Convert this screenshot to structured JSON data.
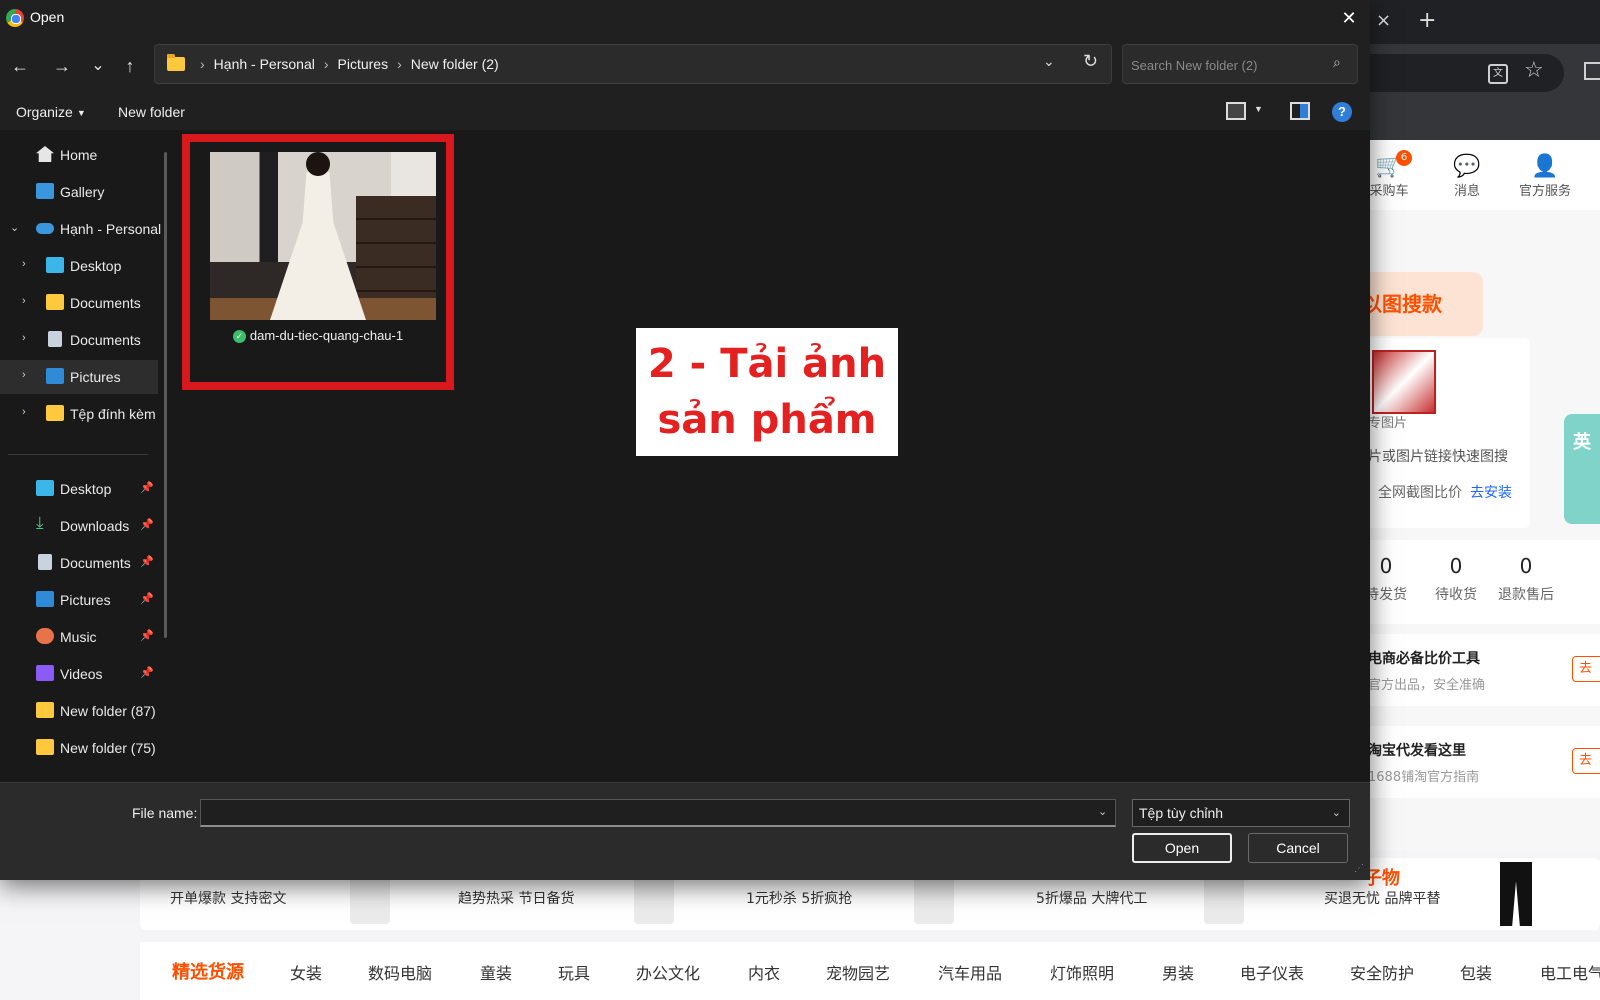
{
  "dialog": {
    "title": "Open",
    "icons": {
      "app": "chrome-logo-icon",
      "close": "close-icon"
    },
    "nav": {
      "back": "←",
      "forward": "→",
      "recent": "⌄",
      "up": "↑",
      "breadcrumbs": [
        "Hạnh - Personal",
        "Pictures",
        "New folder (2)"
      ],
      "search_placeholder": "Search New folder (2)"
    },
    "toolbar": {
      "organize": "Organize",
      "new_folder": "New folder"
    },
    "sidebar": {
      "tree": [
        {
          "label": "Home",
          "icon": "home-icon"
        },
        {
          "label": "Gallery",
          "icon": "gallery-icon"
        },
        {
          "label": "Hạnh - Personal",
          "icon": "onedrive-cloud-icon",
          "expanded": true
        },
        {
          "label": "Desktop",
          "icon": "desktop-icon"
        },
        {
          "label": "Documents",
          "icon": "folder-icon"
        },
        {
          "label": "Documents",
          "icon": "document-icon"
        },
        {
          "label": "Pictures",
          "icon": "pictures-icon",
          "selected": true
        },
        {
          "label": "Tệp đính kèm",
          "icon": "folder-icon"
        }
      ],
      "quick_access": [
        {
          "label": "Desktop",
          "icon": "desktop-icon",
          "pinned": true
        },
        {
          "label": "Downloads",
          "icon": "download-icon",
          "pinned": true
        },
        {
          "label": "Documents",
          "icon": "document-icon",
          "pinned": true
        },
        {
          "label": "Pictures",
          "icon": "pictures-icon",
          "pinned": true
        },
        {
          "label": "Music",
          "icon": "music-icon",
          "pinned": true
        },
        {
          "label": "Videos",
          "icon": "videos-icon",
          "pinned": true
        },
        {
          "label": "New folder (87)",
          "icon": "folder-icon"
        },
        {
          "label": "New folder (75)",
          "icon": "folder-icon"
        }
      ]
    },
    "files": [
      {
        "name": "dam-du-tiec-quang-chau-1",
        "status_icon": "sync-check-icon"
      }
    ],
    "annotation": {
      "line1": "2 - Tải ảnh",
      "line2": "sản phẩm",
      "box_color": "#d7191e"
    },
    "footer": {
      "file_name_label": "File name:",
      "file_name_value": "",
      "file_type": "Tệp tùy chỉnh",
      "open": "Open",
      "cancel": "Cancel"
    }
  },
  "browser_bg": {
    "tab_close": "×",
    "tab_new": "+",
    "header_icons": [
      {
        "label": "采购车",
        "icon": "cart-icon",
        "badge": "6"
      },
      {
        "label": "消息",
        "icon": "message-icon"
      },
      {
        "label": "官方服务",
        "icon": "service-icon"
      }
    ],
    "image_search": {
      "title": "以图搜款",
      "upload_hint": "专图片",
      "hint": "片或图片链接快速图搜",
      "compare": "全网截图比价",
      "install": "去安装",
      "badge": "英"
    },
    "orders": [
      {
        "count": "0",
        "label": "待发货"
      },
      {
        "count": "0",
        "label": "待收货"
      },
      {
        "count": "0",
        "label": "退款售后"
      }
    ],
    "promos": [
      {
        "title": "电商必备比价工具",
        "subtitle": "官方出品，安全准确",
        "action": "去",
        "color": "#ff5000"
      },
      {
        "title": "淘宝代发看这里",
        "subtitle": "1688铺淘官方指南",
        "action": "去",
        "color": "#ff8a3d"
      }
    ],
    "deals": [
      "开单爆款 支持密文",
      "趋势热采 节日备货",
      "1元秒杀 5折疯抢",
      "5折爆品 大牌代工",
      "买退无忧 品牌平替"
    ],
    "deals_tag": "子物",
    "categories": [
      "精选货源",
      "女装",
      "数码电脑",
      "童装",
      "玩具",
      "办公文化",
      "内衣",
      "宠物园艺",
      "汽车用品",
      "灯饰照明",
      "男装",
      "电子仪表",
      "安全防护",
      "包装",
      "电工电气"
    ]
  }
}
